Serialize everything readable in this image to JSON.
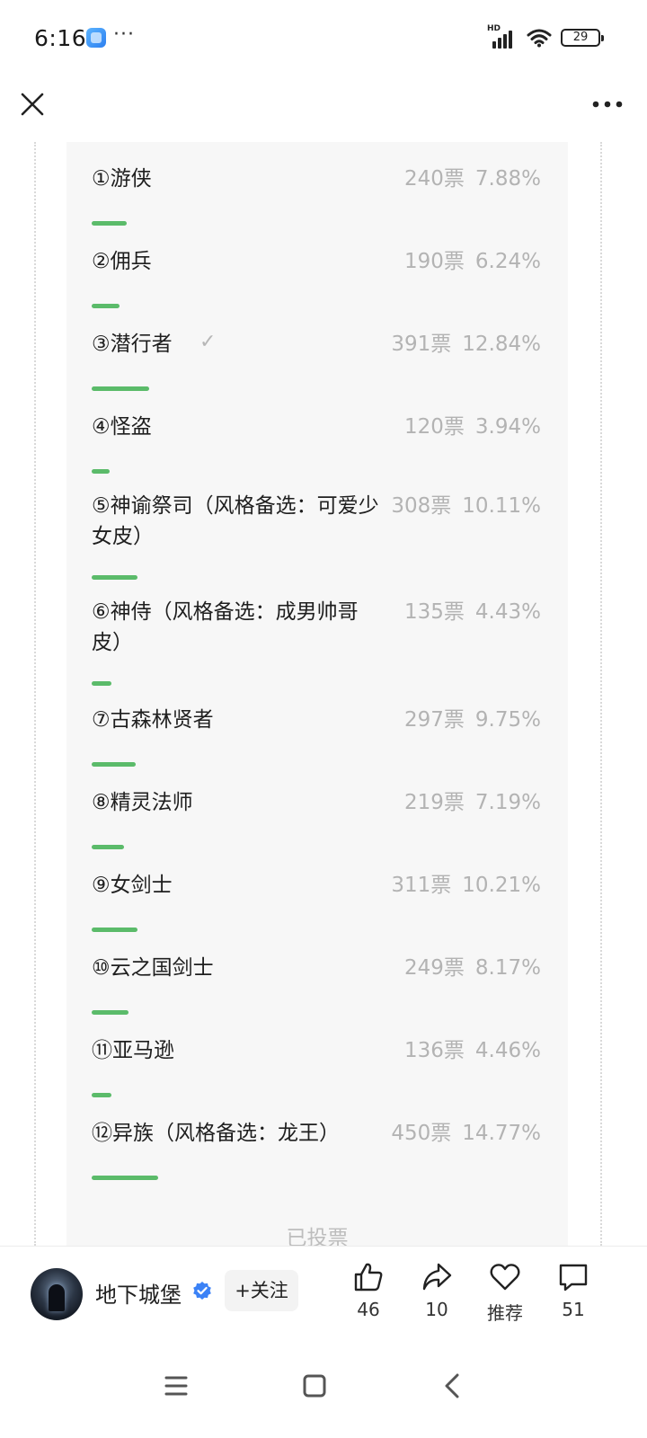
{
  "status_bar": {
    "time": "6:16",
    "dots": "···",
    "network": "HD",
    "battery": "29"
  },
  "nav": {
    "close_icon": "close-icon",
    "more_icon": "more-icon"
  },
  "poll": {
    "options": [
      {
        "label": "①游侠",
        "votes": "240票",
        "percent": "7.88%",
        "share": 7.88,
        "checked": false
      },
      {
        "label": "②佣兵",
        "votes": "190票",
        "percent": "6.24%",
        "share": 6.24,
        "checked": false
      },
      {
        "label": "③潜行者",
        "votes": "391票",
        "percent": "12.84%",
        "share": 12.84,
        "checked": true
      },
      {
        "label": "④怪盗",
        "votes": "120票",
        "percent": "3.94%",
        "share": 3.94,
        "checked": false
      },
      {
        "label": "⑤神谕祭司（风格备选：可爱少女皮）",
        "votes": "308票",
        "percent": "10.11%",
        "share": 10.11,
        "checked": false
      },
      {
        "label": "⑥神侍（风格备选：成男帅哥皮）",
        "votes": "135票",
        "percent": "4.43%",
        "share": 4.43,
        "checked": false
      },
      {
        "label": "⑦古森林贤者",
        "votes": "297票",
        "percent": "9.75%",
        "share": 9.75,
        "checked": false
      },
      {
        "label": "⑧精灵法师",
        "votes": "219票",
        "percent": "7.19%",
        "share": 7.19,
        "checked": false
      },
      {
        "label": "⑨女剑士",
        "votes": "311票",
        "percent": "10.21%",
        "share": 10.21,
        "checked": false
      },
      {
        "label": "⑩云之国剑士",
        "votes": "249票",
        "percent": "8.17%",
        "share": 8.17,
        "checked": false
      },
      {
        "label": "⑪亚马逊",
        "votes": "136票",
        "percent": "4.46%",
        "share": 4.46,
        "checked": false
      },
      {
        "label": "⑫异族（风格备选：龙王）",
        "votes": "450票",
        "percent": "14.77%",
        "share": 14.77,
        "checked": false
      }
    ],
    "voted_label": "已投票",
    "check_icon": "check-icon",
    "bar_color": "#5bbb6a"
  },
  "action_bar": {
    "author": "地下城堡",
    "follow_label": "+关注",
    "like_count": "46",
    "share_count": "10",
    "recommend_label": "推荐",
    "comment_count": "51",
    "verified_color": "#3b82f6"
  },
  "system_nav": {
    "menu_icon": "menu-icon",
    "home_icon": "home-icon",
    "back_icon": "back-icon"
  }
}
